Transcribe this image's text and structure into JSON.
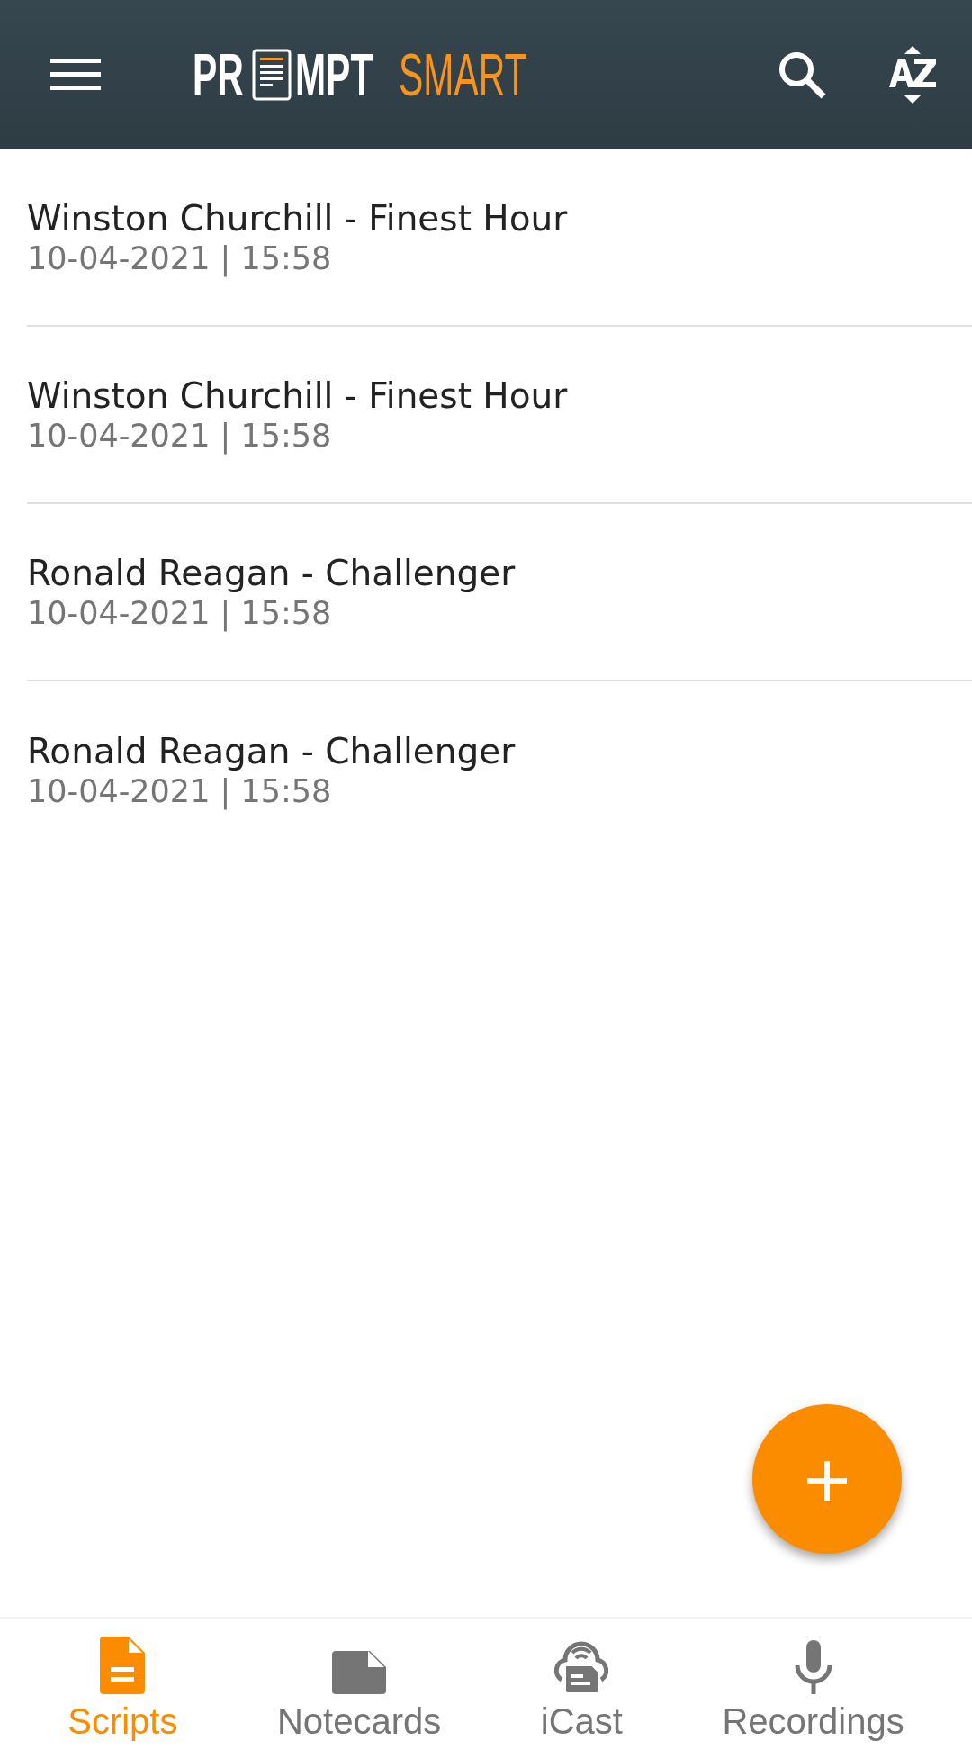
{
  "app_bar": {
    "logo": {
      "prefix": "PR",
      "suffix": "MPT",
      "accent": "SMART"
    }
  },
  "scripts": [
    {
      "title": "Winston Churchill - Finest Hour",
      "date": "10-04-2021 | 15:58"
    },
    {
      "title": "Winston Churchill - Finest Hour",
      "date": "10-04-2021 | 15:58"
    },
    {
      "title": "Ronald Reagan - Challenger",
      "date": "10-04-2021 | 15:58"
    },
    {
      "title": "Ronald Reagan - Challenger",
      "date": "10-04-2021 | 15:58"
    }
  ],
  "fab": {
    "label": "+"
  },
  "bottom_nav": [
    {
      "kind": "scripts",
      "label": "Scripts",
      "selected": true
    },
    {
      "kind": "notecards",
      "label": "Notecards",
      "selected": false
    },
    {
      "kind": "icast",
      "label": "iCast",
      "selected": false
    },
    {
      "kind": "recordings",
      "label": "Recordings",
      "selected": false
    }
  ]
}
